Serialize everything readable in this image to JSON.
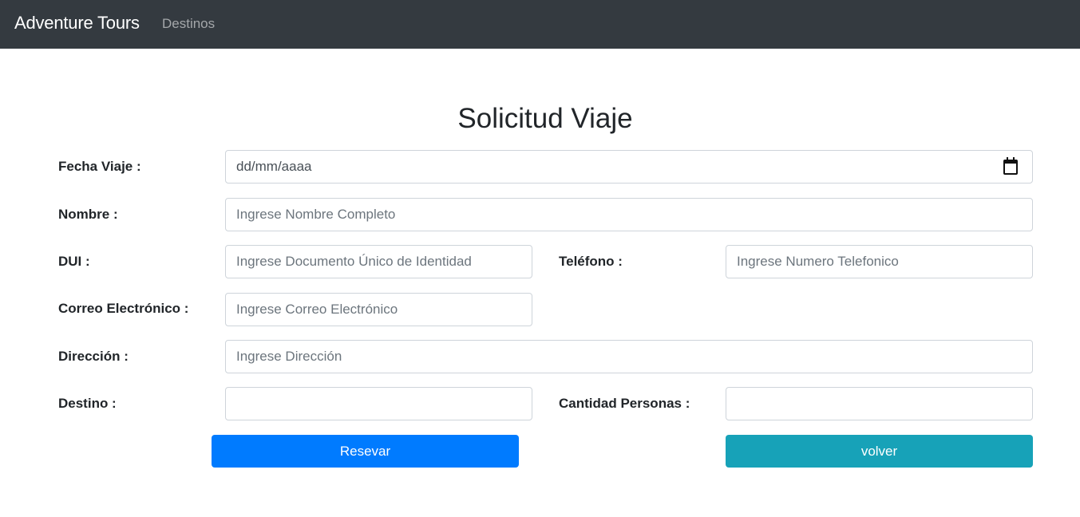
{
  "navbar": {
    "brand": "Adventure Tours",
    "links": [
      "Destinos"
    ]
  },
  "form": {
    "title": "Solicitud Viaje",
    "fecha": {
      "label": "Fecha Viaje :",
      "value": "dd/mm/aaaa",
      "icon": "calendar-icon"
    },
    "nombre": {
      "label": "Nombre :",
      "placeholder": "Ingrese Nombre Completo"
    },
    "dui": {
      "label": "DUI :",
      "placeholder": "Ingrese Documento Único de Identidad"
    },
    "telefono": {
      "label": "Teléfono :",
      "placeholder": "Ingrese Numero Telefonico"
    },
    "correo": {
      "label": "Correo Electrónico :",
      "placeholder": "Ingrese Correo Electrónico"
    },
    "direccion": {
      "label": "Dirección :",
      "placeholder": "Ingrese Dirección"
    },
    "destino": {
      "label": "Destino :",
      "placeholder": ""
    },
    "cantidad": {
      "label": "Cantidad Personas :",
      "placeholder": ""
    },
    "buttons": {
      "reservar": "Resevar",
      "volver": "volver"
    }
  },
  "colors": {
    "navbar_bg": "#343a40",
    "primary": "#007bff",
    "info": "#17a2b8"
  }
}
